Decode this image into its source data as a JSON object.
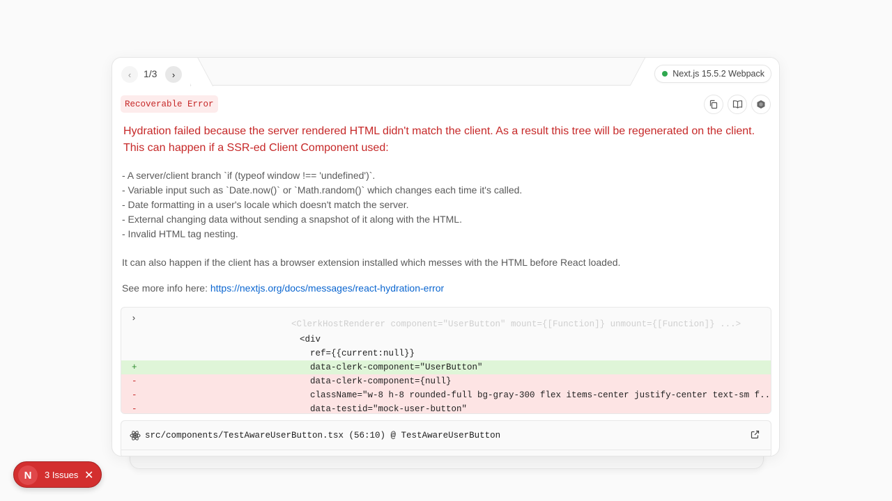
{
  "pager": {
    "text": "1/3",
    "prev": "‹",
    "next": "›"
  },
  "version": {
    "label": "Next.js 15.5.2 Webpack",
    "status_color": "#2fa84f"
  },
  "error": {
    "label": "Recoverable Error",
    "headline": "Hydration failed because the server rendered HTML didn't match the client. As a result this tree will be regenerated on the client. This can happen if a SSR-ed Client Component used:",
    "causes": [
      "- A server/client branch `if (typeof window !== 'undefined')`.",
      "- Variable input such as `Date.now()` or `Math.random()` which changes each time it's called.",
      "- Date formatting in a user's locale which doesn't match the server.",
      "- External changing data without sending a snapshot of it along with the HTML.",
      "- Invalid HTML tag nesting."
    ],
    "extra": "It can also happen if the client has a browser extension installed which messes with the HTML before React loaded.",
    "more_prefix": "See more info here: ",
    "more_link": "https://nextjs.org/docs/messages/react-hydration-error"
  },
  "tools": {
    "copy": "copy-icon",
    "docs": "book-icon",
    "nodejs": "nodejs-hexagon-icon"
  },
  "diff": {
    "toggle": "›",
    "faded": "<ClerkHostRenderer component=\"UserButton\" mount={[Function]} unmount={[Function]} ...>",
    "lines": [
      {
        "type": "context",
        "mark": "",
        "text": "<div",
        "indent": 256
      },
      {
        "type": "context",
        "mark": "",
        "text": "ref={{current:null}}",
        "indent": 271
      },
      {
        "type": "added",
        "mark": "+",
        "text": "data-clerk-component=\"UserButton\"",
        "indent": 271
      },
      {
        "type": "removed",
        "mark": "-",
        "text": "data-clerk-component={null}",
        "indent": 271
      },
      {
        "type": "removed",
        "mark": "-",
        "text": "className=\"w-8 h-8 rounded-full bg-gray-300 flex items-center justify-center text-sm f...\"",
        "indent": 271
      },
      {
        "type": "removed",
        "mark": "-",
        "text": "data-testid=\"mock-user-button\"",
        "indent": 271
      }
    ]
  },
  "source": {
    "location": "src/components/TestAwareUserButton.tsx (56:10) @ TestAwareUserButton"
  },
  "issues": {
    "logo": "N",
    "label": "3 Issues",
    "close": "✕"
  }
}
